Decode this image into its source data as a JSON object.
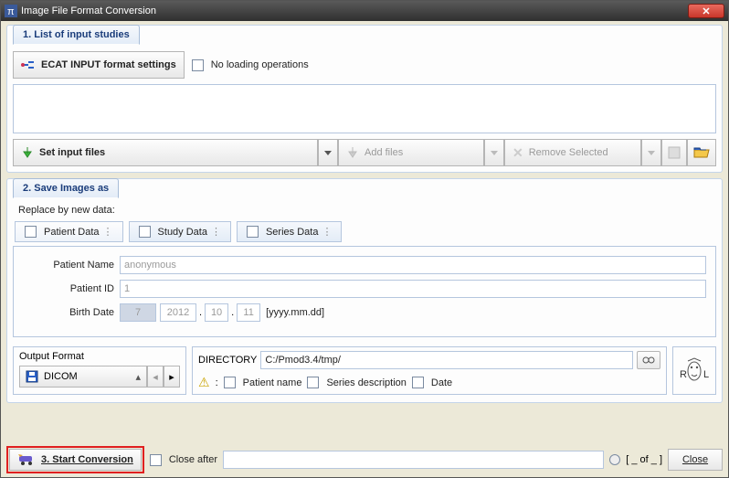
{
  "window": {
    "title": "Image File Format Conversion"
  },
  "section1": {
    "tab": "1. List of input studies",
    "ecat_btn": "ECAT INPUT format settings",
    "no_loading": "No loading operations",
    "set_input": "Set input files",
    "add_files": "Add files",
    "remove_selected": "Remove Selected"
  },
  "section2": {
    "tab": "2. Save Images as",
    "replace_label": "Replace by new data:",
    "tabs": {
      "patient": "Patient Data",
      "study": "Study Data",
      "series": "Series Data"
    },
    "form": {
      "name_label": "Patient Name",
      "name_value": "anonymous",
      "id_label": "Patient ID",
      "id_value": "1",
      "birth_label": "Birth Date",
      "birth_day": "7",
      "birth_year": "2012",
      "birth_month": "10",
      "birth_dd": "11",
      "birth_hint": "[yyyy.mm.dd]"
    },
    "output": {
      "label": "Output Format",
      "format": "DICOM",
      "dir_label": "DIRECTORY",
      "dir_value": "C:/Pmod3.4/tmp/",
      "warn_sep": ":",
      "chk_patient": "Patient name",
      "chk_series": "Series description",
      "chk_date": "Date"
    }
  },
  "footer": {
    "start": "3. Start Conversion",
    "close_after": "Close after",
    "count": "[ _ of _ ]",
    "close": "Close"
  }
}
